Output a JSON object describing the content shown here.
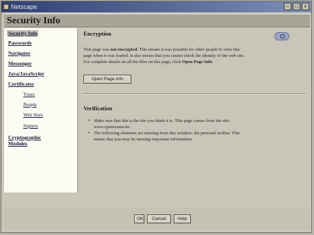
{
  "window": {
    "title": "Netscape"
  },
  "header": {
    "title": "Security Info"
  },
  "sidebar": {
    "items": [
      {
        "label": "Security Info"
      },
      {
        "label": "Passwords"
      },
      {
        "label": "Navigator"
      },
      {
        "label": "Messenger"
      },
      {
        "label": "Java/JavaScript"
      },
      {
        "label": "Certificates"
      }
    ],
    "certificate_subitems": [
      {
        "label": "Yours"
      },
      {
        "label": "People"
      },
      {
        "label": "Web Sites"
      },
      {
        "label": "Signers"
      }
    ],
    "crypto_line1": "Cryptographic",
    "crypto_line2": "Modules"
  },
  "encryption": {
    "title": "Encryption",
    "line1_a": "This page was ",
    "line1_b": "not encrypted",
    "line1_c": ". This means it was possible for other people to view this",
    "line2": "page when it was loaded. It also means that you cannot check the identity of the web site.",
    "line3_a": "For complete details on all the files on this page, click ",
    "line3_b": "Open Page Info",
    "line3_c": ".",
    "button": "Open Page Info"
  },
  "verification": {
    "title": "Verification",
    "bullet1_line1": "Make sure that this is the site you think it is. This page comes from the site:",
    "bullet1_line2": "www.cpanorama.ho",
    "bullet2_line1": "The following elements are missing from this window: the personal toolbar. This",
    "bullet2_line2": "means that you may be missing important information."
  },
  "footer": {
    "ok": "OK",
    "cancel": "Cancel",
    "help": "Help"
  }
}
